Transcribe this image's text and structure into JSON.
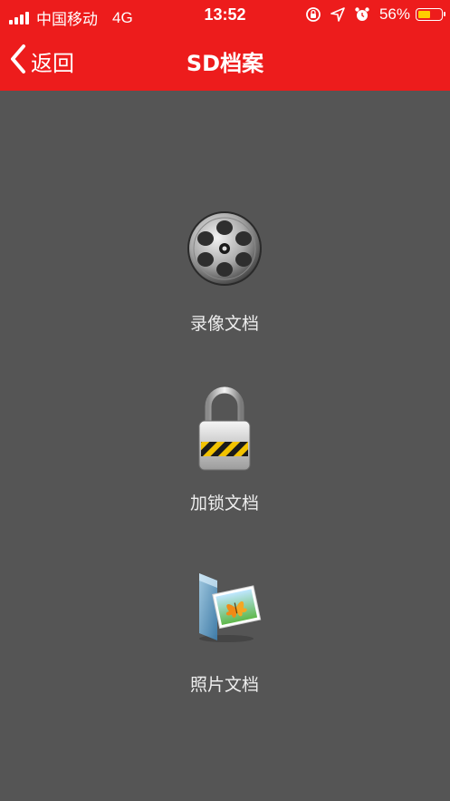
{
  "status_bar": {
    "carrier": "中国移动",
    "network": "4G",
    "time": "13:52",
    "battery_percent": "56%",
    "battery_level": 0.56,
    "battery_color": "#ffcc00",
    "icons": [
      "orientation-lock-icon",
      "location-arrow-icon",
      "alarm-clock-icon"
    ]
  },
  "nav": {
    "back_label": "返回",
    "title": "SD档案",
    "bar_color": "#ed1c1c"
  },
  "background_color": "#555555",
  "menu": {
    "items": [
      {
        "icon": "film-reel-icon",
        "label": "录像文档"
      },
      {
        "icon": "padlock-icon",
        "label": "加锁文档"
      },
      {
        "icon": "photo-icon",
        "label": "照片文档"
      }
    ]
  }
}
